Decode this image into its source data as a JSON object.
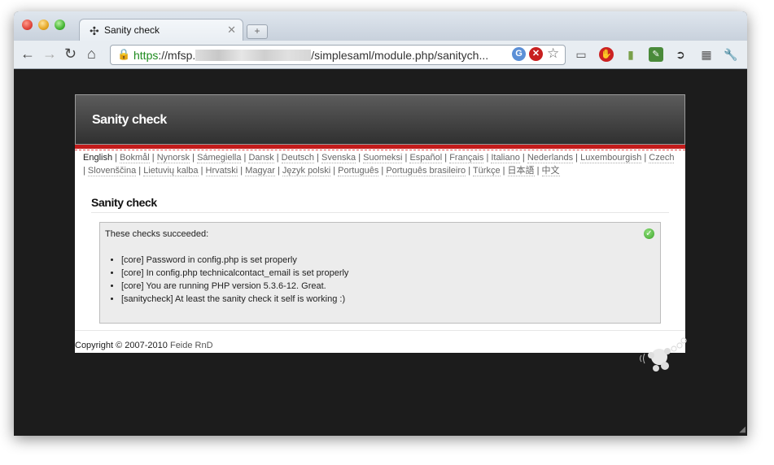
{
  "browser": {
    "tab_title": "Sanity check",
    "tab_icon": "puzzle-icon",
    "url_scheme": "https",
    "url_host_start": "://mfsp.",
    "url_path": "/simplesaml/module.php/sanitych..."
  },
  "page": {
    "header_title": "Sanity check",
    "languages": [
      "English",
      "Bokmål",
      "Nynorsk",
      "Sámegiella",
      "Dansk",
      "Deutsch",
      "Svenska",
      "Suomeksi",
      "Español",
      "Français",
      "Italiano",
      "Nederlands",
      "Luxembourgish",
      "Czech",
      "Slovenščina",
      "Lietuvių kalba",
      "Hrvatski",
      "Magyar",
      "Język polski",
      "Português",
      "Português brasileiro",
      "Türkçe",
      "日本語",
      "中文"
    ],
    "heading": "Sanity check",
    "box_title": "These checks succeeded:",
    "checks": [
      "[core] Password in config.php is set properly",
      "[core] In config.php technicalcontact_email is set properly",
      "[core] You are running PHP version 5.3.6-12. Great.",
      "[sanitycheck] At least the sanity check it self is working :)"
    ],
    "copyright_text": "Copyright © 2007-2010 ",
    "copyright_link": "Feide RnD"
  }
}
